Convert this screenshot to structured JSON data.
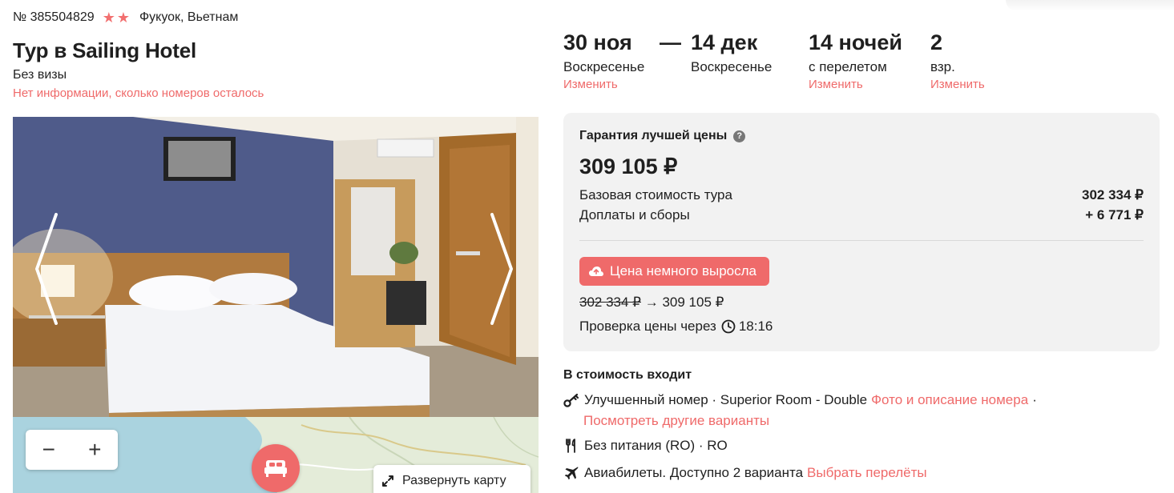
{
  "tour": {
    "number": "№ 385504829",
    "stars": 2,
    "location": "Фукуок, Вьетнам",
    "title": "Тур в Sailing Hotel",
    "visa": "Без визы",
    "rooms_note": "Нет информации, сколько номеров осталось"
  },
  "dates": {
    "from": {
      "date": "30 ноя",
      "weekday": "Воскресенье",
      "change": "Изменить"
    },
    "separator": "—",
    "to": {
      "date": "14 дек",
      "weekday": "Воскресенье"
    },
    "nights": {
      "value": "14 ночей",
      "note": "с перелетом",
      "change": "Изменить"
    },
    "guests": {
      "value": "2",
      "note": "взр.",
      "change": "Изменить"
    }
  },
  "price": {
    "guarantee": "Гарантия лучшей цены",
    "total": "309 105 ₽",
    "base_label": "Базовая стоимость тура",
    "base_value": "302 334 ₽",
    "fees_label": "Доплаты и сборы",
    "fees_value": "+ 6 771 ₽",
    "badge": "Цена немного выросла",
    "old_price": "302 334 ₽",
    "arrow": "→",
    "new_price": "309 105 ₽",
    "check_label": "Проверка цены через",
    "check_time": "18:16"
  },
  "included": {
    "title": "В стоимость входит",
    "room_text": "Улучшенный номер · Superior Room - Double",
    "room_link": "Фото и описание номера",
    "room_sep": "·",
    "room_other": "Посмотреть другие варианты",
    "meal": "Без питания (RO) · RO",
    "flights_text": "Авиабилеты. Доступно 2 варианта",
    "flights_link": "Выбрать перелёты"
  },
  "map": {
    "zoom_out": "−",
    "zoom_in": "+",
    "expand": "Развернуть карту"
  },
  "icons": {
    "star": "star-icon",
    "question": "question-icon",
    "cloud": "cloud-up-icon",
    "clock": "clock-icon",
    "key": "key-icon",
    "cutlery": "cutlery-icon",
    "plane": "plane-icon",
    "bed": "bed-icon",
    "expand": "expand-icon"
  },
  "colors": {
    "accent": "#ef6a6a",
    "card_bg": "#f2f2f2",
    "text": "#1f1f1f"
  }
}
